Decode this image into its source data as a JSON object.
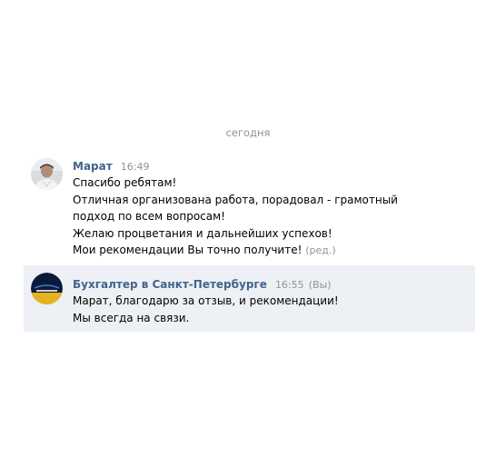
{
  "date_separator": "сегодня",
  "messages": [
    {
      "author": "Марат",
      "time": "16:49",
      "lines": [
        "Спасибо ребятам!",
        "Отличная организована работа, порадовал - грамотный",
        "подход по всем вопросам!",
        "Желаю процветания и дальнейших успехов!",
        "Мои рекомендации Вы точно получите!"
      ],
      "edited_label": "(ред.)",
      "avatar": "user-photo-avatar"
    },
    {
      "author": "Бухгалтер в Санкт-Петербурге",
      "time": "16:55",
      "you_label": "(Вы)",
      "lines": [
        "Марат, благодарю за отзыв, и рекомендации!",
        "Мы всегда на связи."
      ],
      "avatar": "company-logo-avatar"
    }
  ],
  "colors": {
    "author": "#42648b",
    "meta": "#939393",
    "highlight_bg": "#edf0f5",
    "text": "#000000"
  }
}
